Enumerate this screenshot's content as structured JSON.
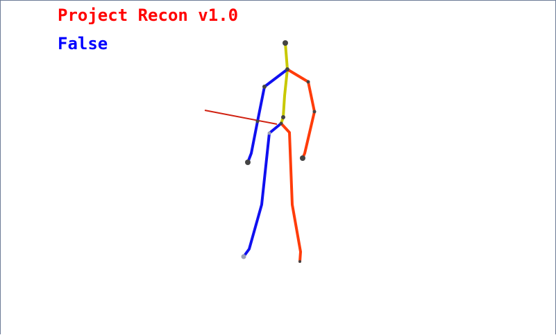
{
  "app": {
    "title": "Project Recon v1.0",
    "status": "False"
  },
  "colors": {
    "title": "#ff0000",
    "status": "#0000ff",
    "spine": "#c8c800",
    "left_side": "#1010f0",
    "right_side": "#ff3c0a",
    "joint": "#444444",
    "pointer_line": "#d02010"
  }
}
